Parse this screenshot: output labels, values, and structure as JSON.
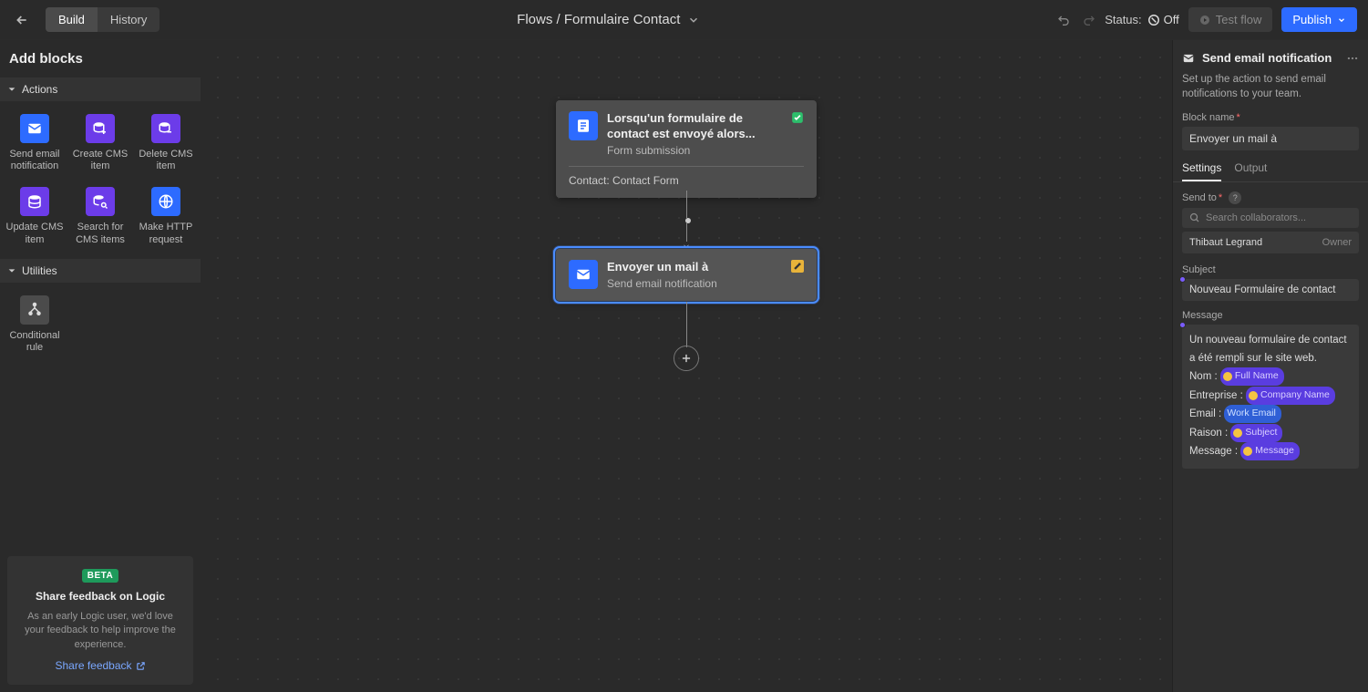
{
  "topbar": {
    "tabs": {
      "build": "Build",
      "history": "History"
    },
    "breadcrumb": "Flows / Formulaire Contact",
    "status_label": "Status:",
    "status_value": "Off",
    "test_flow": "Test flow",
    "publish": "Publish"
  },
  "left": {
    "title": "Add blocks",
    "sections": {
      "actions": "Actions",
      "utilities": "Utilities"
    },
    "blocks": {
      "send_email": "Send email notification",
      "create_cms": "Create CMS item",
      "delete_cms": "Delete CMS item",
      "update_cms": "Update CMS item",
      "search_cms": "Search for CMS items",
      "http": "Make HTTP request",
      "conditional": "Conditional rule"
    },
    "feedback": {
      "badge": "BETA",
      "title": "Share feedback on Logic",
      "desc": "As an early Logic user, we'd love your feedback to help improve the experience.",
      "link": "Share feedback"
    }
  },
  "canvas": {
    "trigger": {
      "title": "Lorsqu'un formulaire de contact est envoyé alors...",
      "subtitle": "Form submission",
      "meta": "Contact: Contact Form"
    },
    "action": {
      "title": "Envoyer un mail à",
      "subtitle": "Send email notification"
    }
  },
  "right": {
    "title": "Send email notification",
    "desc": "Set up the action to send email notifications to your team.",
    "block_name_label": "Block name",
    "block_name_value": "Envoyer un mail à",
    "tabs": {
      "settings": "Settings",
      "output": "Output"
    },
    "send_to_label": "Send to",
    "search_placeholder": "Search collaborators...",
    "collab_name": "Thibaut Legrand",
    "collab_role": "Owner",
    "subject_label": "Subject",
    "subject_value": "Nouveau Formulaire de contact",
    "message_label": "Message",
    "message_intro": "Un nouveau formulaire de contact a été rempli sur le site web.",
    "msg_lines": {
      "nom": "Nom : ",
      "entreprise": "Entreprise : ",
      "email": "Email : ",
      "raison": "Raison : ",
      "message": "Message : "
    },
    "tokens": {
      "full_name": "Full Name",
      "company": "Company Name",
      "work_email": "Work Email",
      "subject": "Subject",
      "message": "Message"
    }
  }
}
